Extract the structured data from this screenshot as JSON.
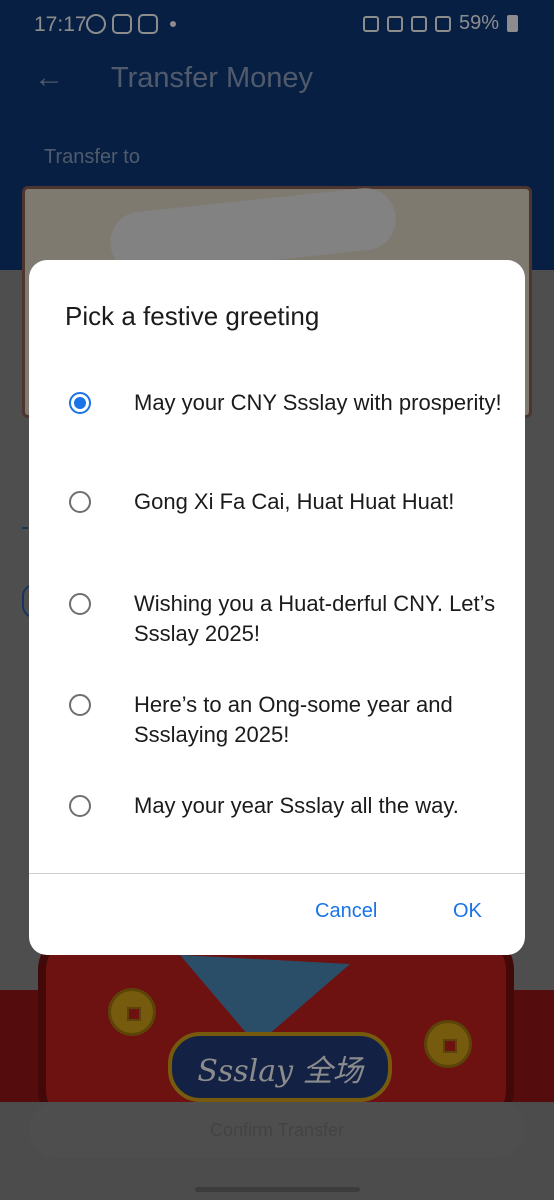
{
  "status_bar": {
    "time": "17:17",
    "battery": "59%",
    "left_icons": [
      "whatsapp-icon",
      "instagram-icon",
      "app-icon"
    ],
    "right_icons": [
      "alarm-icon",
      "mute-icon",
      "wifi-icon",
      "call-icon",
      "signal-icon",
      "battery-icon"
    ]
  },
  "header": {
    "title": "Transfer Money",
    "back_icon": "arrow-left-icon"
  },
  "page": {
    "transfer_to_label": "Transfer to",
    "confirm_button": "Confirm Transfer",
    "banner_slogan": "Ssslay 全场"
  },
  "dialog": {
    "title": "Pick a festive greeting",
    "options": [
      {
        "label": "May your CNY Ssslay with prosperity!",
        "selected": true
      },
      {
        "label": "Gong Xi Fa Cai, Huat Huat Huat!",
        "selected": false
      },
      {
        "label": "Wishing you a Huat-derful CNY. Let’s Ssslay 2025!",
        "selected": false
      },
      {
        "label": "Here’s to an Ong-some year and Ssslaying 2025!",
        "selected": false
      },
      {
        "label": "May your year Ssslay all the way.",
        "selected": false
      }
    ],
    "cancel_label": "Cancel",
    "ok_label": "OK"
  },
  "colors": {
    "app_bar": "#0b3a7a",
    "accent": "#1a73e8",
    "banner_red": "#c72020"
  }
}
